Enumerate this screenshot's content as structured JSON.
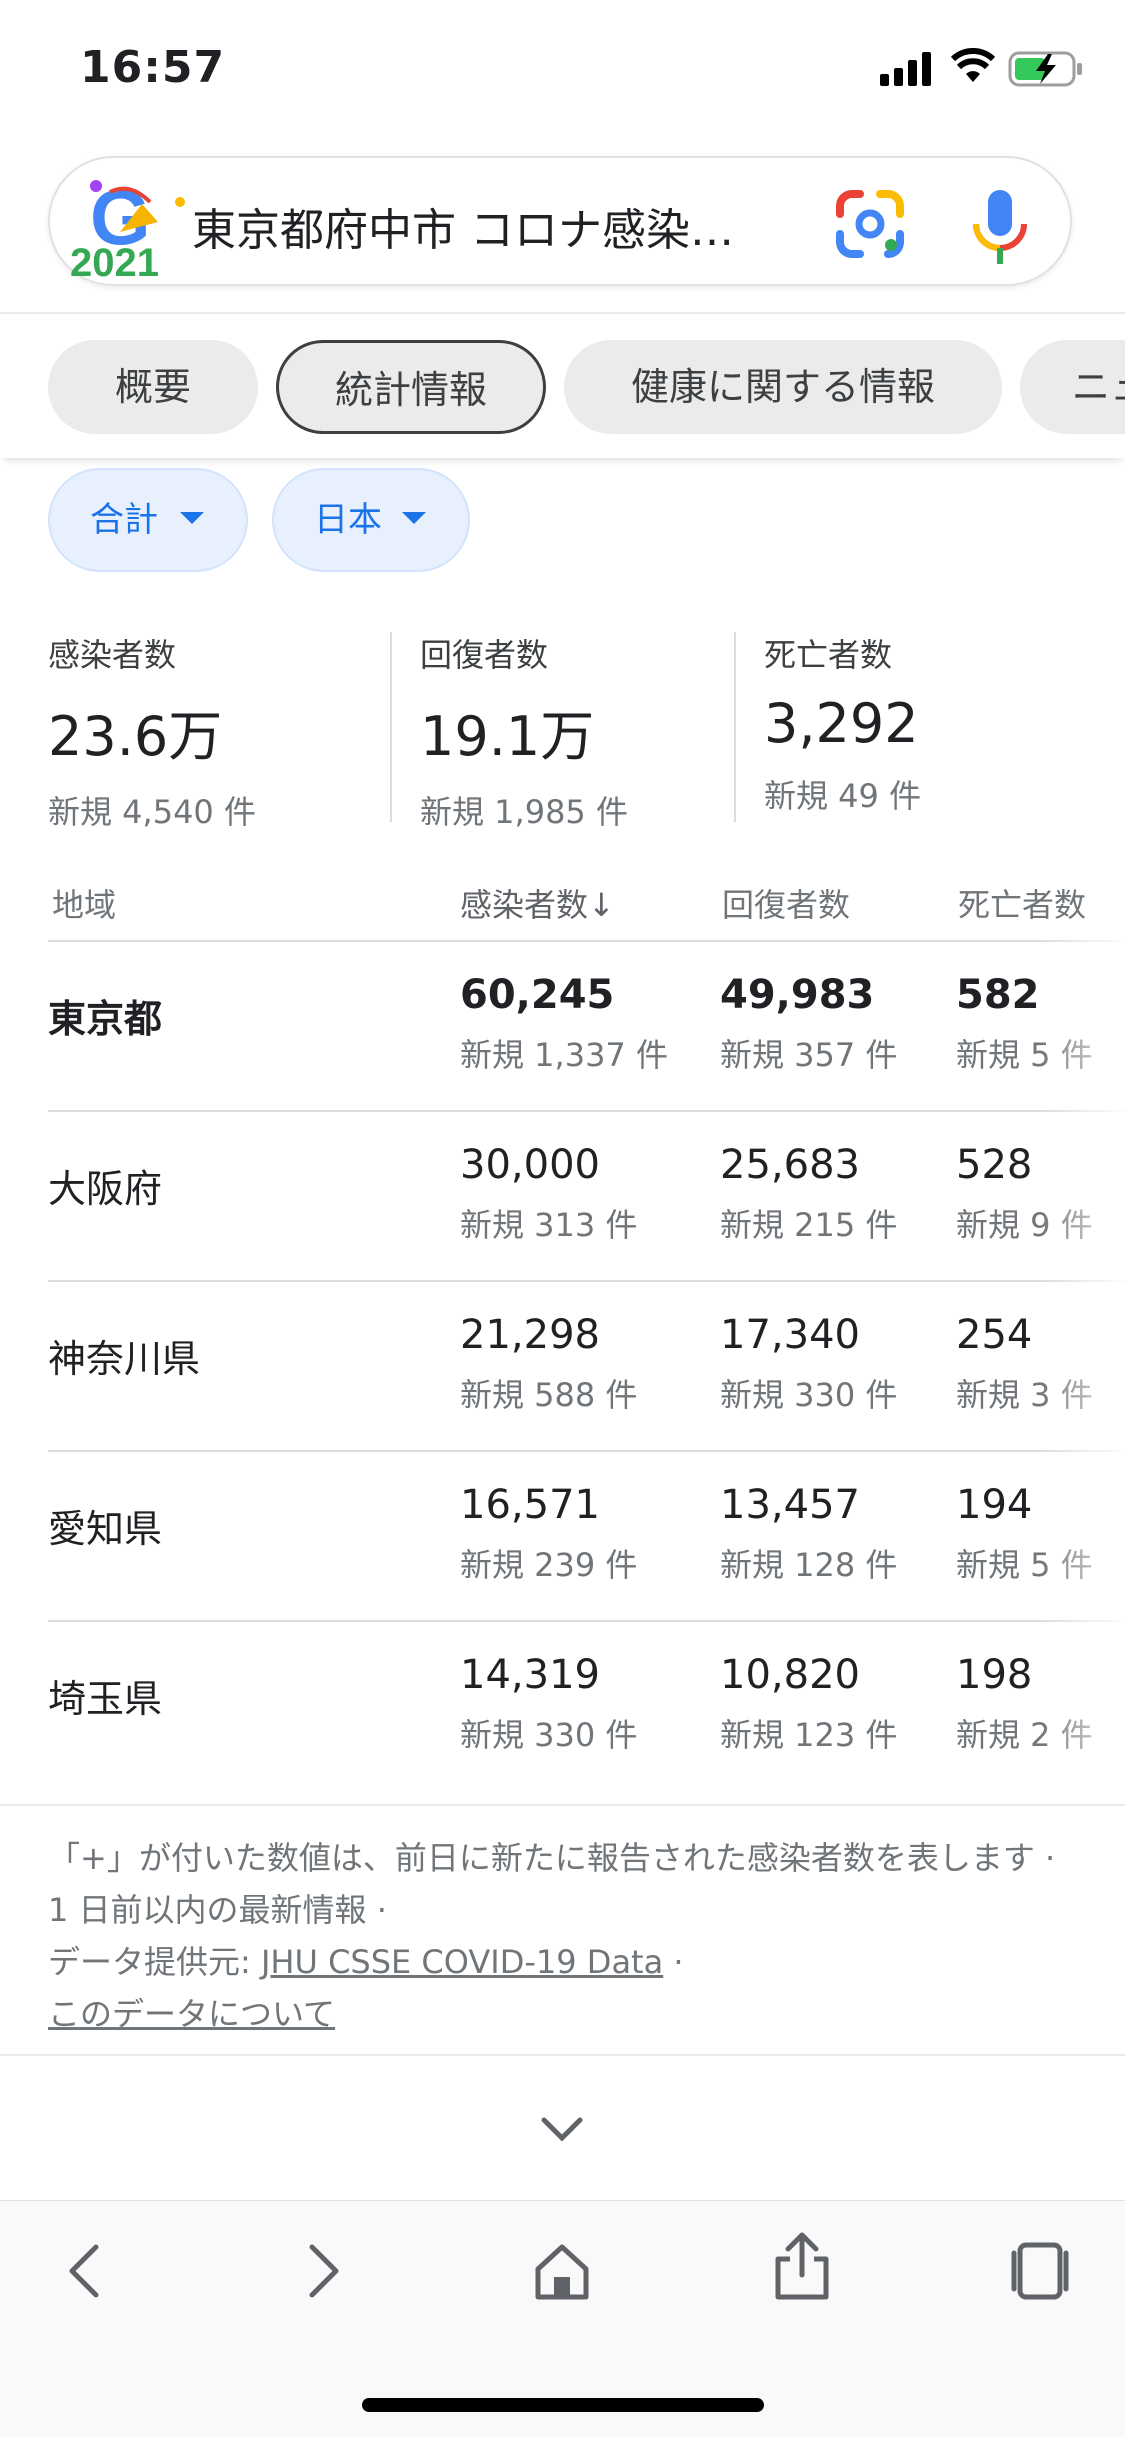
{
  "status_bar": {
    "time": "16:57"
  },
  "search": {
    "query": "東京都府中市 コロナ感染…",
    "doodle_text": "2021"
  },
  "tabs": [
    {
      "label": "概要",
      "active": false
    },
    {
      "label": "統計情報",
      "active": true
    },
    {
      "label": "健康に関する情報",
      "active": false
    },
    {
      "label": "ニュ",
      "active": false
    }
  ],
  "filters": {
    "scope": "合計",
    "country": "日本"
  },
  "summary": {
    "infected": {
      "title": "感染者数",
      "value": "23.6万",
      "new": "新規 4,540 件"
    },
    "recovered": {
      "title": "回復者数",
      "value": "19.1万",
      "new": "新規 1,985 件"
    },
    "deaths": {
      "title": "死亡者数",
      "value": "3,292",
      "new": "新規 49 件"
    }
  },
  "table": {
    "headers": {
      "region": "地域",
      "infected": "感染者数↓",
      "recovered": "回復者数",
      "deaths": "死亡者数"
    },
    "rows": [
      {
        "region": "東京都",
        "infected": "60,245",
        "infected_new": "新規 1,337 件",
        "recovered": "49,983",
        "recovered_new": "新規 357 件",
        "deaths": "582",
        "deaths_new": "新規 5 件"
      },
      {
        "region": "大阪府",
        "infected": "30,000",
        "infected_new": "新規 313 件",
        "recovered": "25,683",
        "recovered_new": "新規 215 件",
        "deaths": "528",
        "deaths_new": "新規 9 件"
      },
      {
        "region": "神奈川県",
        "infected": "21,298",
        "infected_new": "新規 588 件",
        "recovered": "17,340",
        "recovered_new": "新規 330 件",
        "deaths": "254",
        "deaths_new": "新規 3 件"
      },
      {
        "region": "愛知県",
        "infected": "16,571",
        "infected_new": "新規 239 件",
        "recovered": "13,457",
        "recovered_new": "新規 128 件",
        "deaths": "194",
        "deaths_new": "新規 5 件"
      },
      {
        "region": "埼玉県",
        "infected": "14,319",
        "infected_new": "新規 330 件",
        "recovered": "10,820",
        "recovered_new": "新規 123 件",
        "deaths": "198",
        "deaths_new": "新規 2 件"
      }
    ]
  },
  "notes": {
    "line1": "「+」が付いた数値は、前日に新たに報告された感染者数を表します · 1 日前以内の最新情報",
    "source_prefix": "データ提供元:",
    "source_link": "JHU CSSE COVID-19 Data",
    "about_link": "このデータについて"
  },
  "colors": {
    "accent_blue": "#1a73e8",
    "chip_bg": "#ebebeb",
    "filter_bg": "#e8f0fe"
  }
}
